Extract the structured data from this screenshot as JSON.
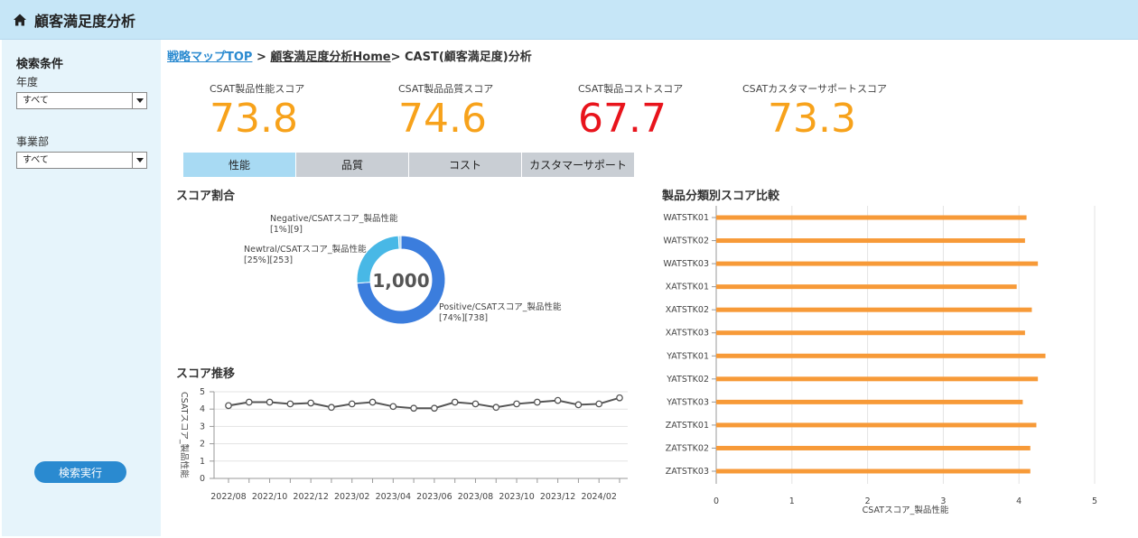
{
  "header": {
    "title": "顧客満足度分析",
    "icon": "home-icon"
  },
  "sidebar": {
    "section_title": "検索条件",
    "year_label": "年度",
    "year_value": "すべて",
    "division_label": "事業部",
    "division_value": "すべて",
    "search_button": "検索実行"
  },
  "breadcrumb": {
    "link1": "戦略マップTOP",
    "sep1": " > ",
    "link2": "顧客満足度分析Home",
    "sep2": "> ",
    "current": "CAST(顧客満足度)分析"
  },
  "kpis": [
    {
      "label": "CSAT製品性能スコア",
      "value": "73.8",
      "color": "#f7a21b"
    },
    {
      "label": "CSAT製品品質スコア",
      "value": "74.6",
      "color": "#f7a21b"
    },
    {
      "label": "CSAT製品コストスコア",
      "value": "67.7",
      "color": "#e8141c"
    },
    {
      "label": "CSATカスタマーサポートスコア",
      "value": "73.3",
      "color": "#f7a21b"
    }
  ],
  "tabs": [
    {
      "label": "性能",
      "active": true
    },
    {
      "label": "品質",
      "active": false
    },
    {
      "label": "コスト",
      "active": false
    },
    {
      "label": "カスタマーサポート",
      "active": false
    }
  ],
  "panels": {
    "ratio_title": "スコア割合",
    "trend_title": "スコア推移",
    "compare_title": "製品分類別スコア比較"
  },
  "chart_data": [
    {
      "type": "pie",
      "center_label": "1,000",
      "slices": [
        {
          "name": "Positive/CSATスコア_製品性能",
          "label": "[74%][738]",
          "value": 738,
          "color": "#3b7ddd"
        },
        {
          "name": "Newtral/CSATスコア_製品性能",
          "label": "[25%][253]",
          "value": 253,
          "color": "#48b8e6"
        },
        {
          "name": "Negative/CSATスコア_製品性能",
          "label": "[1%][9]",
          "value": 9,
          "color": "#a6d5ee"
        }
      ]
    },
    {
      "type": "line",
      "ylabel": "CSATスコア_製品性能",
      "ylim": [
        0,
        5
      ],
      "yticks": [
        "0",
        "1",
        "2",
        "3",
        "4",
        "5"
      ],
      "xtick_labels": [
        "2022/08",
        "2022/10",
        "2022/12",
        "2023/02",
        "2023/04",
        "2023/06",
        "2023/08",
        "2023/10",
        "2023/12",
        "2024/02"
      ],
      "x": [
        "2022/08",
        "2022/09",
        "2022/10",
        "2022/11",
        "2022/12",
        "2023/01",
        "2023/02",
        "2023/03",
        "2023/04",
        "2023/05",
        "2023/06",
        "2023/07",
        "2023/08",
        "2023/09",
        "2023/10",
        "2023/11",
        "2023/12",
        "2024/01",
        "2024/02",
        "2024/03"
      ],
      "values": [
        4.2,
        4.4,
        4.4,
        4.3,
        4.35,
        4.1,
        4.3,
        4.4,
        4.15,
        4.05,
        4.05,
        4.4,
        4.3,
        4.1,
        4.3,
        4.4,
        4.5,
        4.25,
        4.3,
        4.65
      ],
      "color": "#555555"
    },
    {
      "type": "bar",
      "orientation": "horizontal",
      "xlabel": "CSATスコア_製品性能",
      "xlim": [
        0,
        5
      ],
      "xticks": [
        "0",
        "1",
        "2",
        "3",
        "4",
        "5"
      ],
      "categories": [
        "WATSTK01",
        "WATSTK02",
        "WATSTK03",
        "XATSTK01",
        "XATSTK02",
        "XATSTK03",
        "YATSTK01",
        "YATSTK02",
        "YATSTK03",
        "ZATSTK01",
        "ZATSTK02",
        "ZATSTK03"
      ],
      "values": [
        4.1,
        4.08,
        4.25,
        3.97,
        4.17,
        4.08,
        4.35,
        4.25,
        4.05,
        4.23,
        4.15,
        4.15
      ],
      "color": "#f79a38"
    }
  ]
}
